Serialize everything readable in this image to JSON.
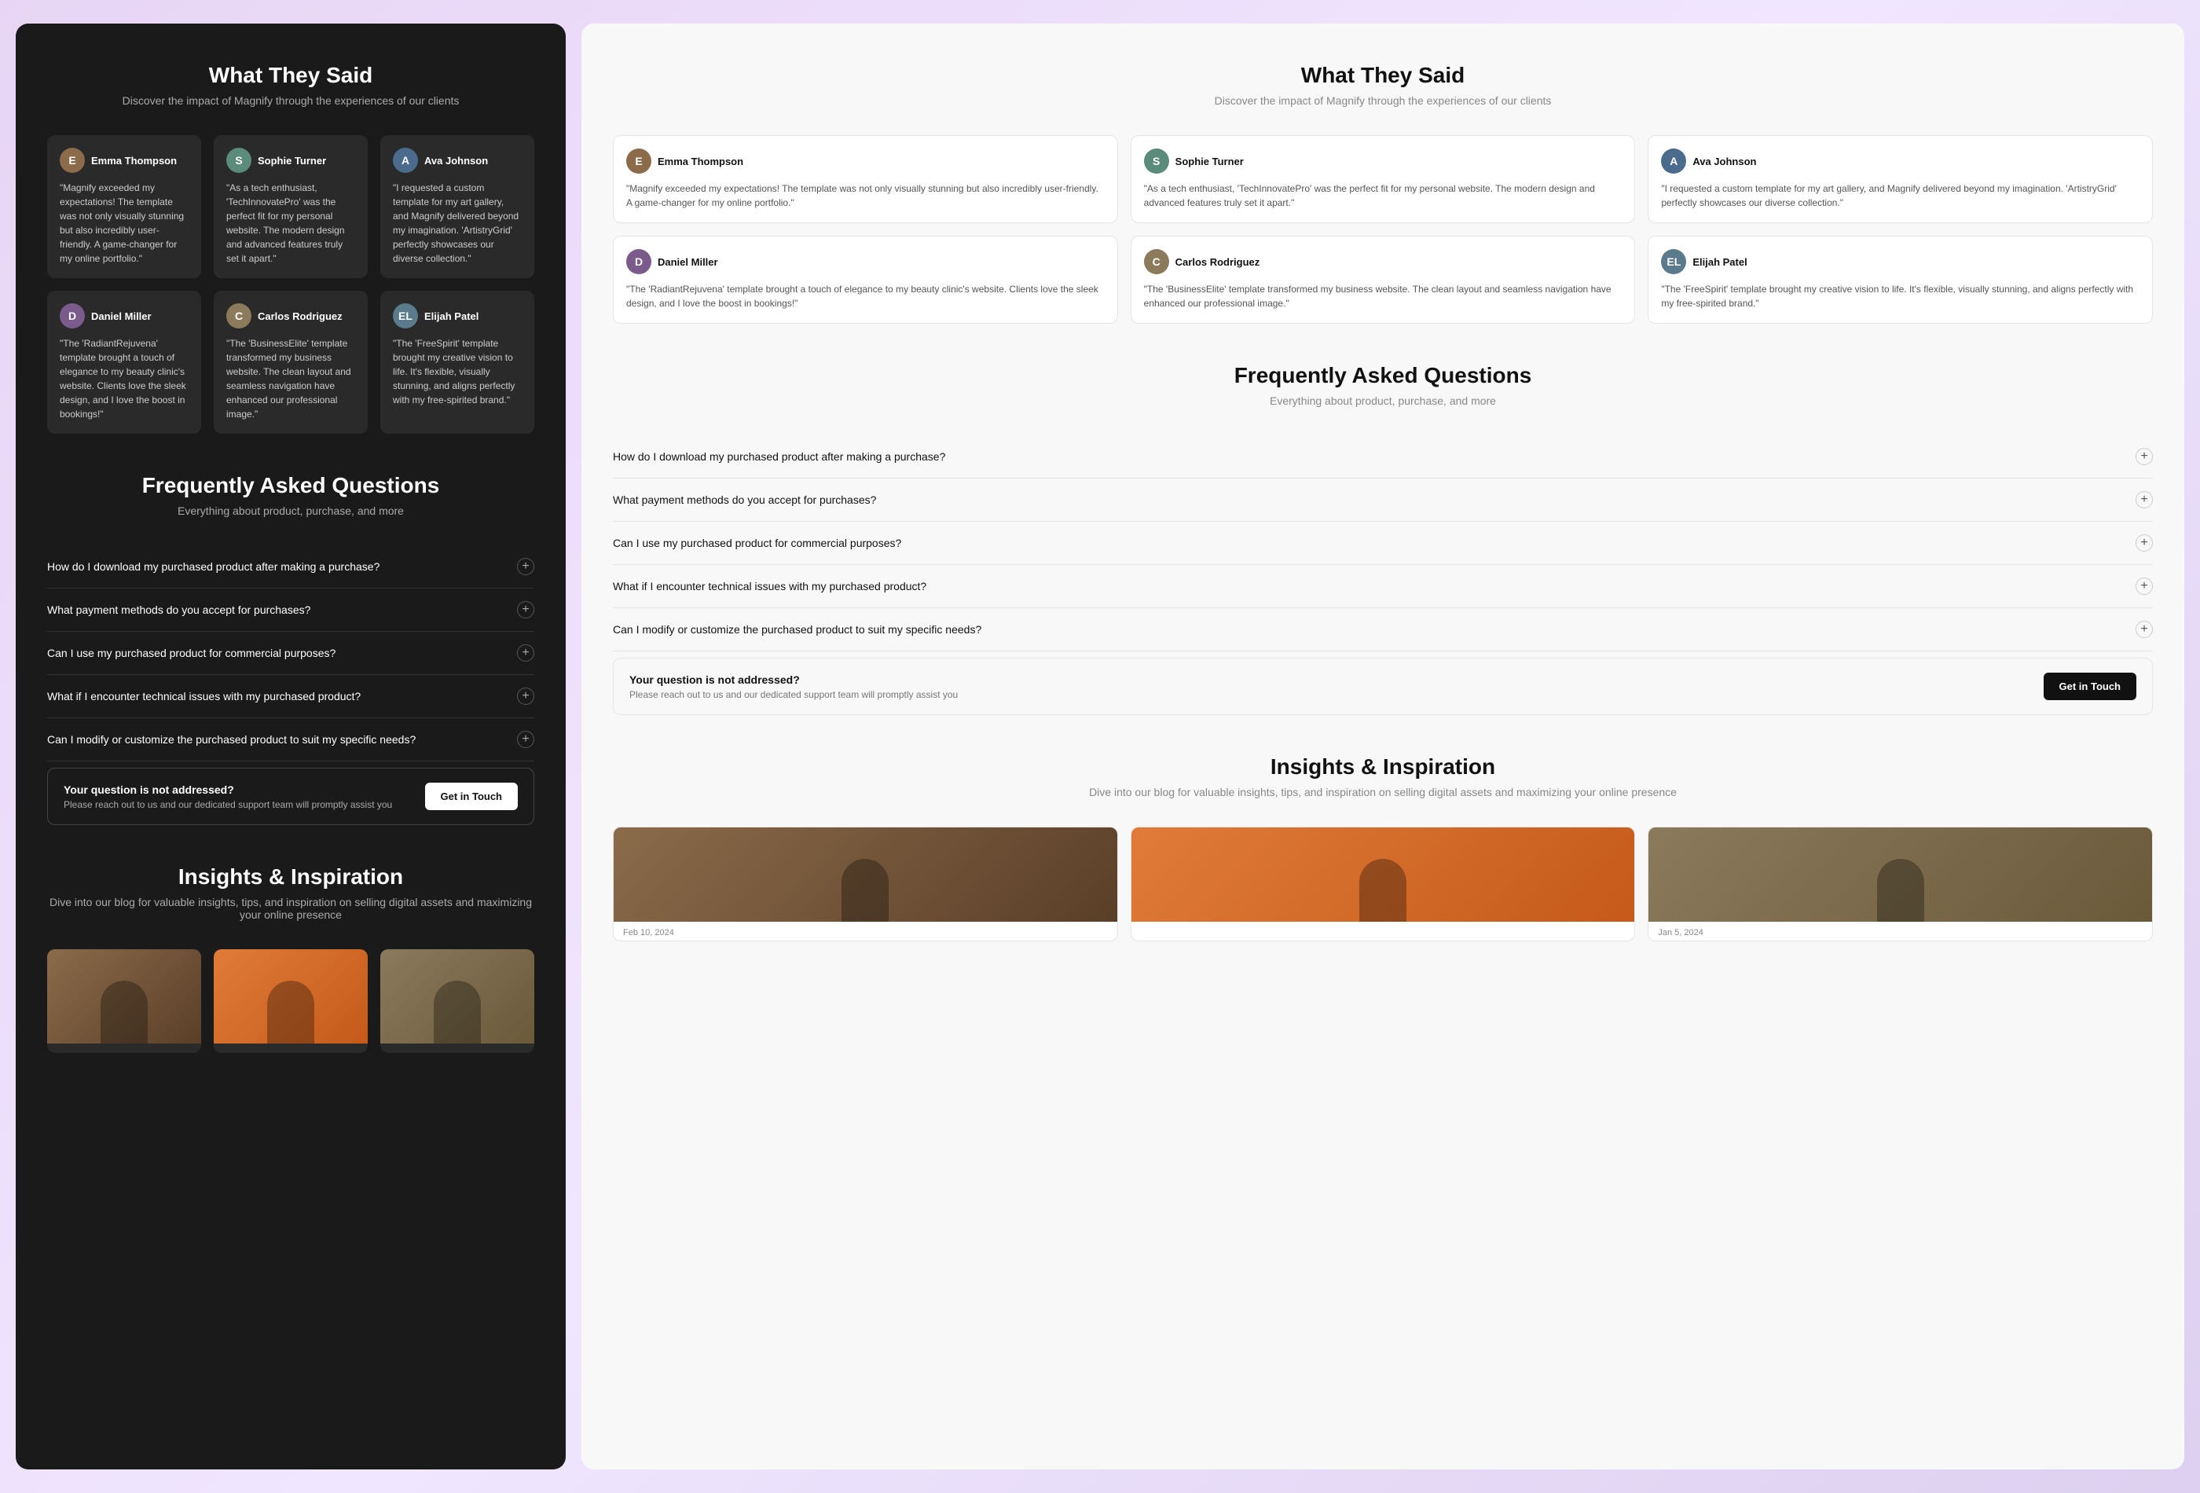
{
  "dark_panel": {
    "testimonials": {
      "title": "What They Said",
      "subtitle": "Discover the impact of Magnify through the experiences of our clients",
      "cards": [
        {
          "name": "Emma Thompson",
          "avatar_letter": "E",
          "avatar_class": "avatar-emma",
          "text": "\"Magnify exceeded my expectations! The template was not only visually stunning but also incredibly user-friendly. A game-changer for my online portfolio.\""
        },
        {
          "name": "Sophie Turner",
          "avatar_letter": "S",
          "avatar_class": "avatar-sophie",
          "text": "\"As a tech enthusiast, 'TechInnovatePro' was the perfect fit for my personal website. The modern design and advanced features truly set it apart.\""
        },
        {
          "name": "Ava Johnson",
          "avatar_letter": "A",
          "avatar_class": "avatar-ava",
          "text": "\"I requested a custom template for my art gallery, and Magnify delivered beyond my imagination. 'ArtistryGrid' perfectly showcases our diverse collection.\""
        },
        {
          "name": "Daniel Miller",
          "avatar_letter": "D",
          "avatar_class": "avatar-daniel",
          "text": "\"The 'RadiantRejuvena' template brought a touch of elegance to my beauty clinic's website. Clients love the sleek design, and I love the boost in bookings!\""
        },
        {
          "name": "Carlos Rodriguez",
          "avatar_letter": "C",
          "avatar_class": "avatar-carlos",
          "text": "\"The 'BusinessElite' template transformed my business website. The clean layout and seamless navigation have enhanced our professional image.\""
        },
        {
          "name": "Elijah Patel",
          "avatar_letter": "EL",
          "avatar_class": "avatar-elijah",
          "text": "\"The 'FreeSpirit' template brought my creative vision to life. It's flexible, visually stunning, and aligns perfectly with my free-spirited brand.\""
        }
      ]
    },
    "faq": {
      "title": "Frequently Asked Questions",
      "subtitle": "Everything about product, purchase, and more",
      "questions": [
        "How do I download my purchased product after making a purchase?",
        "What payment methods do you accept for purchases?",
        "Can I use my purchased product for commercial purposes?",
        "What if I encounter technical issues with my purchased product?",
        "Can I modify or customize the purchased product to suit my specific needs?"
      ],
      "contact": {
        "title": "Your question is not addressed?",
        "subtitle": "Please reach out to us and our dedicated support team will promptly assist you",
        "button_label": "Get in Touch"
      }
    },
    "insights": {
      "title": "Insights & Inspiration",
      "subtitle": "Dive into our blog for valuable insights, tips, and inspiration on selling digital assets and maximizing your online presence",
      "posts": [
        {
          "date": ""
        },
        {
          "date": ""
        },
        {
          "date": ""
        }
      ]
    }
  },
  "light_panel": {
    "testimonials": {
      "title": "What They Said",
      "subtitle": "Discover the impact of Magnify through the experiences of our clients",
      "cards": [
        {
          "name": "Emma Thompson",
          "avatar_letter": "E",
          "avatar_class": "avatar-emma",
          "text": "\"Magnify exceeded my expectations! The template was not only visually stunning but also incredibly user-friendly. A game-changer for my online portfolio.\""
        },
        {
          "name": "Sophie Turner",
          "avatar_letter": "S",
          "avatar_class": "avatar-sophie",
          "text": "\"As a tech enthusiast, 'TechInnovatePro' was the perfect fit for my personal website. The modern design and advanced features truly set it apart.\""
        },
        {
          "name": "Ava Johnson",
          "avatar_letter": "A",
          "avatar_class": "avatar-ava",
          "text": "\"I requested a custom template for my art gallery, and Magnify delivered beyond my imagination. 'ArtistryGrid' perfectly showcases our diverse collection.\""
        },
        {
          "name": "Daniel Miller",
          "avatar_letter": "D",
          "avatar_class": "avatar-daniel",
          "text": "\"The 'RadiantRejuvena' template brought a touch of elegance to my beauty clinic's website. Clients love the sleek design, and I love the boost in bookings!\""
        },
        {
          "name": "Carlos Rodriguez",
          "avatar_letter": "C",
          "avatar_class": "avatar-carlos",
          "text": "\"The 'BusinessElite' template transformed my business website. The clean layout and seamless navigation have enhanced our professional image.\""
        },
        {
          "name": "Elijah Patel",
          "avatar_letter": "EL",
          "avatar_class": "avatar-elijah",
          "text": "\"The 'FreeSpirit' template brought my creative vision to life. It's flexible, visually stunning, and aligns perfectly with my free-spirited brand.\""
        }
      ]
    },
    "faq": {
      "title": "Frequently Asked Questions",
      "subtitle": "Everything about product, purchase, and more",
      "questions": [
        "How do I download my purchased product after making a purchase?",
        "What payment methods do you accept for purchases?",
        "Can I use my purchased product for commercial purposes?",
        "What if I encounter technical issues with my purchased product?",
        "Can I modify or customize the purchased product to suit my specific needs?"
      ],
      "contact": {
        "title": "Your question is not addressed?",
        "subtitle": "Please reach out to us and our dedicated support team will promptly assist you",
        "button_label": "Get in Touch"
      }
    },
    "insights": {
      "title": "Insights & Inspiration",
      "subtitle": "Dive into our blog for valuable insights, tips, and inspiration on selling digital assets and maximizing your online presence",
      "posts": [
        {
          "date": "Feb 10, 2024"
        },
        {
          "date": ""
        },
        {
          "date": "Jan 5, 2024"
        }
      ]
    }
  }
}
